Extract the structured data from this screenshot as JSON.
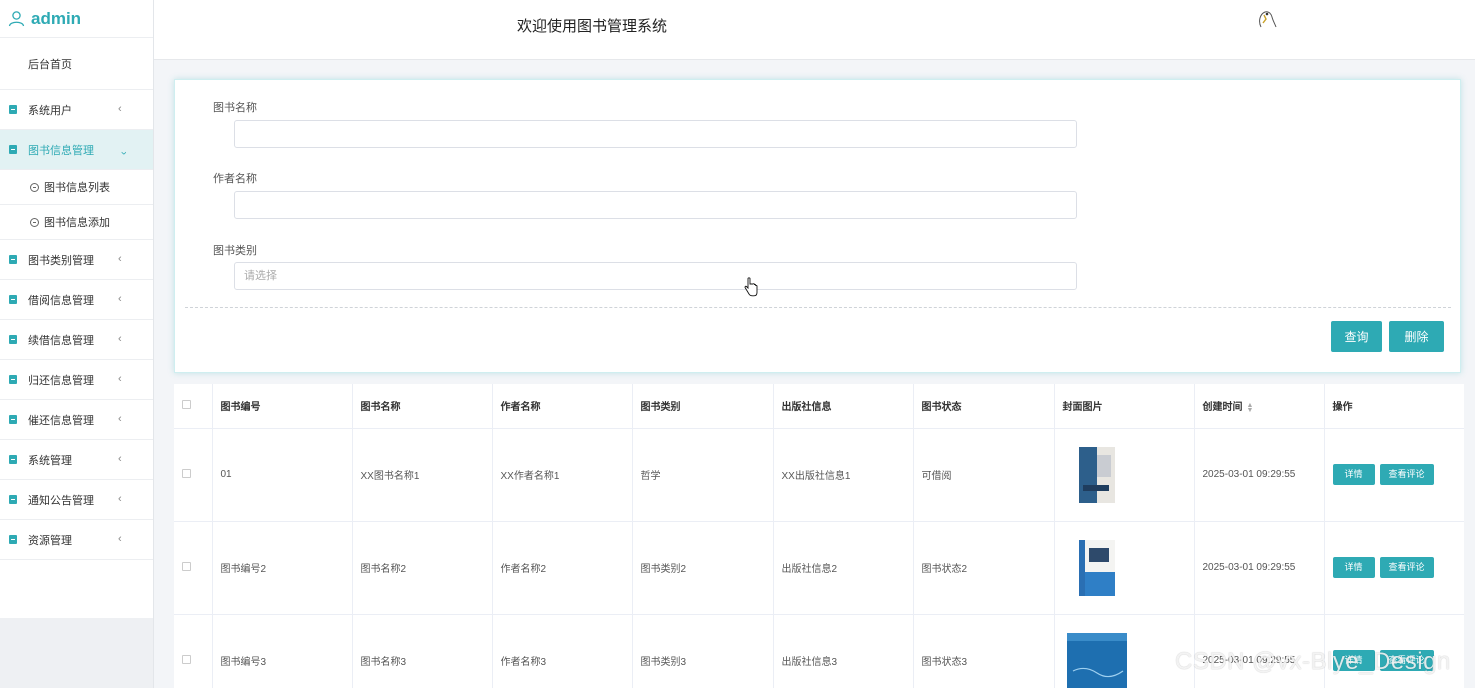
{
  "sidebar": {
    "brand": "admin",
    "home": "后台首页",
    "items": [
      {
        "label": "系统用户"
      },
      {
        "label": "图书信息管理",
        "active": true,
        "children": [
          "图书信息列表",
          "图书信息添加"
        ]
      },
      {
        "label": "图书类别管理"
      },
      {
        "label": "借阅信息管理"
      },
      {
        "label": "续借信息管理"
      },
      {
        "label": "归还信息管理"
      },
      {
        "label": "催还信息管理"
      },
      {
        "label": "系统管理"
      },
      {
        "label": "通知公告管理"
      },
      {
        "label": "资源管理"
      }
    ]
  },
  "header": {
    "title": "欢迎使用图书管理系统"
  },
  "search": {
    "book_name_label": "图书名称",
    "book_name_value": "",
    "author_label": "作者名称",
    "author_value": "",
    "category_label": "图书类别",
    "category_placeholder": "请选择",
    "query_button": "查询",
    "delete_button": "删除"
  },
  "table": {
    "headers": [
      "图书编号",
      "图书名称",
      "作者名称",
      "图书类别",
      "出版社信息",
      "图书状态",
      "封面图片",
      "创建时间",
      "操作"
    ],
    "rows": [
      {
        "id": "01",
        "name": "XX图书名称1",
        "author": "XX作者名称1",
        "category": "哲学",
        "publisher": "XX出版社信息1",
        "status": "可借阅",
        "created": "2025-03-01 09:29:55"
      },
      {
        "id": "图书编号2",
        "name": "图书名称2",
        "author": "作者名称2",
        "category": "图书类别2",
        "publisher": "出版社信息2",
        "status": "图书状态2",
        "created": "2025-03-01 09:29:55"
      },
      {
        "id": "图书编号3",
        "name": "图书名称3",
        "author": "作者名称3",
        "category": "图书类别3",
        "publisher": "出版社信息3",
        "status": "图书状态3",
        "created": "2025-03-01 09:29:55"
      }
    ],
    "detail_button": "详情",
    "comment_button": "查看评论"
  },
  "watermark": "CSDN @vx-Blye_Design",
  "colors": {
    "accent": "#2eaab4"
  }
}
